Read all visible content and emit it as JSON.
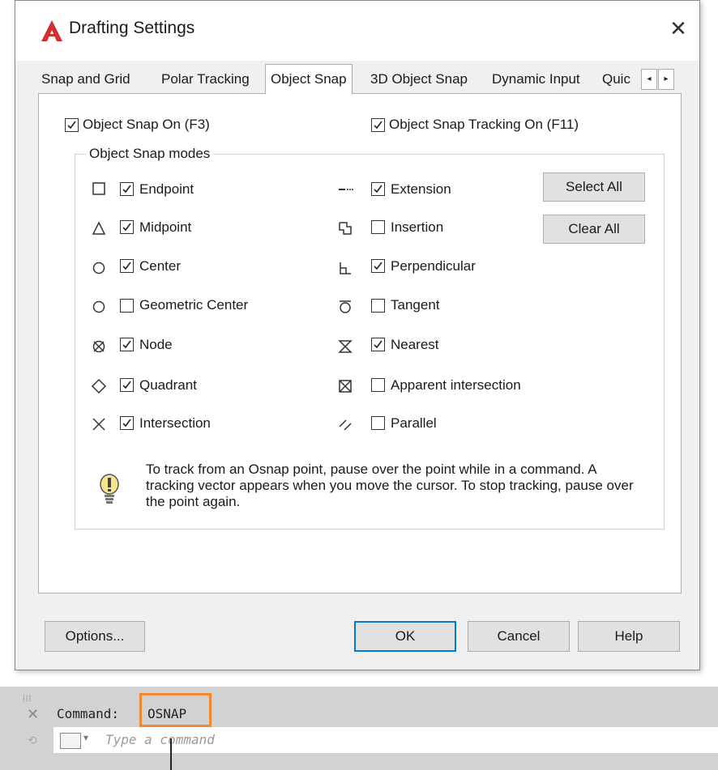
{
  "dialog": {
    "title": "Drafting Settings",
    "close_glyph": "✕",
    "tabs": [
      "Snap and Grid",
      "Polar Tracking",
      "Object Snap",
      "3D Object Snap",
      "Dynamic Input",
      "Quic"
    ],
    "active_tab": "Object Snap",
    "scroll_left": "◂",
    "scroll_right": "▸"
  },
  "object_snap": {
    "snap_on": {
      "label": "Object Snap On (F3)",
      "checked": true
    },
    "tracking_on": {
      "label": "Object Snap Tracking On (F11)",
      "checked": true
    },
    "group_label": "Object Snap modes",
    "left_modes": [
      {
        "label": "Endpoint",
        "checked": true,
        "icon": "endpoint-square-icon"
      },
      {
        "label": "Midpoint",
        "checked": true,
        "icon": "midpoint-triangle-icon"
      },
      {
        "label": "Center",
        "checked": true,
        "icon": "center-circle-icon"
      },
      {
        "label": "Geometric Center",
        "checked": false,
        "icon": "geometric-center-icon"
      },
      {
        "label": "Node",
        "checked": true,
        "icon": "node-icon"
      },
      {
        "label": "Quadrant",
        "checked": true,
        "icon": "quadrant-diamond-icon"
      },
      {
        "label": "Intersection",
        "checked": true,
        "icon": "intersection-x-icon"
      }
    ],
    "right_modes": [
      {
        "label": "Extension",
        "checked": true,
        "icon": "extension-icon"
      },
      {
        "label": "Insertion",
        "checked": false,
        "icon": "insertion-icon"
      },
      {
        "label": "Perpendicular",
        "checked": true,
        "icon": "perpendicular-icon"
      },
      {
        "label": "Tangent",
        "checked": false,
        "icon": "tangent-icon"
      },
      {
        "label": "Nearest",
        "checked": true,
        "icon": "nearest-hourglass-icon"
      },
      {
        "label": "Apparent intersection",
        "checked": false,
        "icon": "apparent-intersection-icon"
      },
      {
        "label": "Parallel",
        "checked": false,
        "icon": "parallel-icon"
      }
    ],
    "select_all": "Select All",
    "clear_all": "Clear All",
    "hint": "To track from an Osnap point, pause over the point while in a command.  A tracking vector appears when you move the cursor.  To stop tracking, pause over the point again."
  },
  "buttons": {
    "options": "Options...",
    "ok": "OK",
    "cancel": "Cancel",
    "help": "Help"
  },
  "command_line": {
    "label": "Command:",
    "value": "OSNAP",
    "placeholder": "Type a command"
  },
  "colors": {
    "accent_orange": "#f08a2c",
    "ok_border": "#0078d7",
    "logo_red": "#d32f2f"
  }
}
